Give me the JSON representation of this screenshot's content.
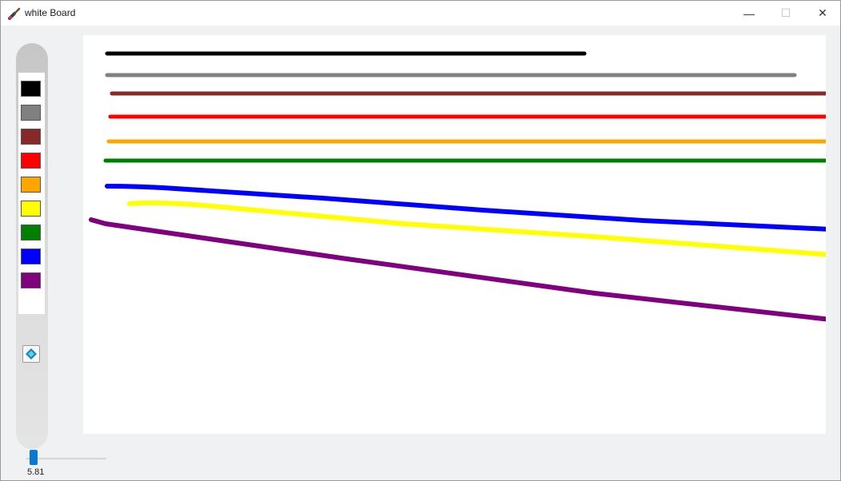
{
  "window": {
    "title": "white Board",
    "controls": {
      "minimize": "—",
      "maximize": "☐",
      "close": "✕"
    }
  },
  "palette": {
    "colors": [
      {
        "name": "black",
        "hex": "#000000"
      },
      {
        "name": "gray",
        "hex": "#808080"
      },
      {
        "name": "brown",
        "hex": "#882828"
      },
      {
        "name": "red",
        "hex": "#ff0000"
      },
      {
        "name": "orange",
        "hex": "#ffa500"
      },
      {
        "name": "yellow",
        "hex": "#ffff00"
      },
      {
        "name": "green",
        "hex": "#008000"
      },
      {
        "name": "blue",
        "hex": "#0000ff"
      },
      {
        "name": "purple",
        "hex": "#800080"
      }
    ],
    "eraser_icon": "eraser-icon"
  },
  "brush_size": {
    "value": "5.81",
    "accent": "#0a78d7"
  },
  "strokes": [
    {
      "color": "#000000"
    },
    {
      "color": "#808080"
    },
    {
      "color": "#882828"
    },
    {
      "color": "#ff0000"
    },
    {
      "color": "#ffa500"
    },
    {
      "color": "#008000"
    },
    {
      "color": "#0000ff"
    },
    {
      "color": "#ffff00"
    },
    {
      "color": "#800080"
    }
  ]
}
